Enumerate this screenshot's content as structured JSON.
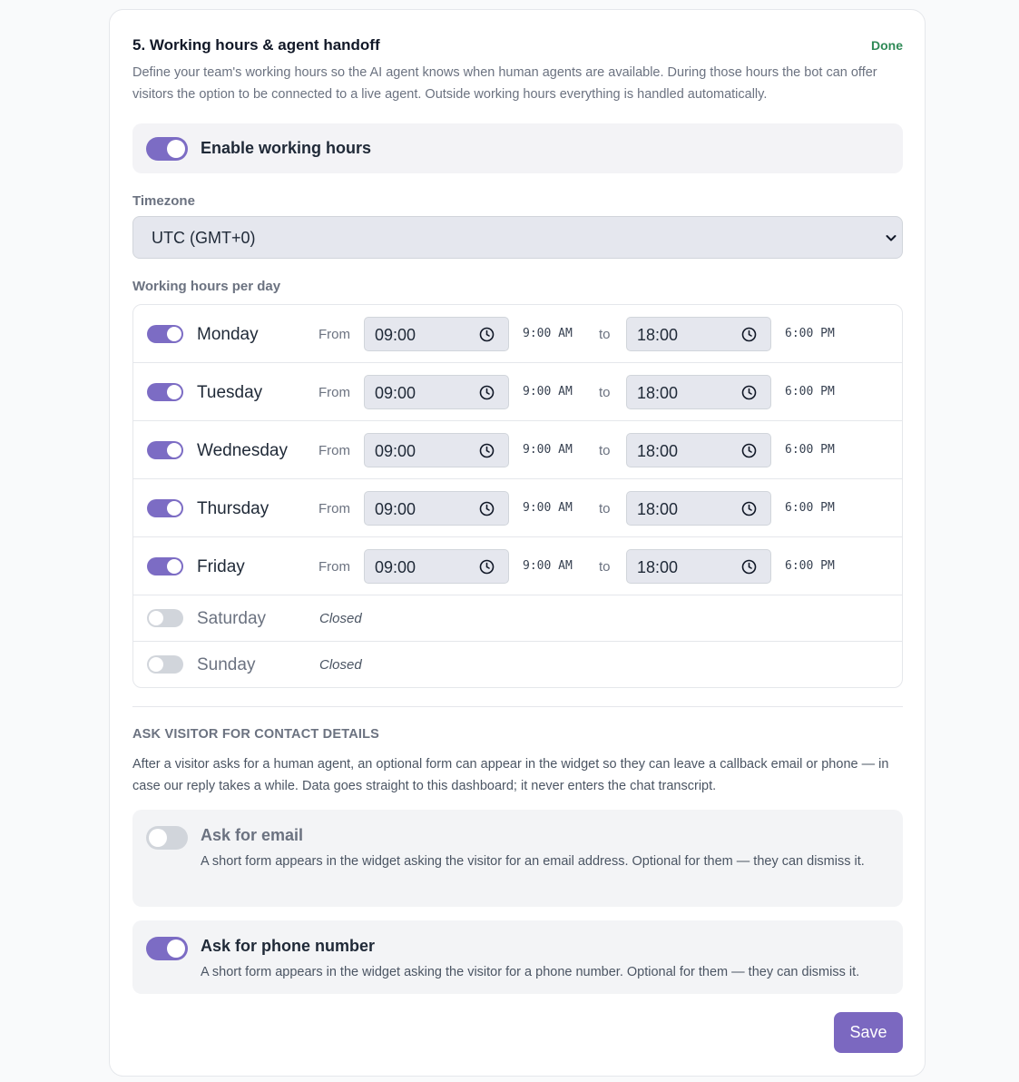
{
  "section": {
    "title": "5. Working hours & agent handoff",
    "status": "Done",
    "description": "Define your team's working hours so the AI agent knows when human agents are available. During those hours the bot can offer visitors the option to be connected to a live agent. Outside working hours everything is handled automatically."
  },
  "enable": {
    "label": "Enable working hours",
    "enabled": true
  },
  "timezone": {
    "label": "Timezone",
    "value": "UTC (GMT+0)"
  },
  "hours": {
    "label": "Working hours per day",
    "from_label": "From",
    "to_label": "to",
    "closed_label": "Closed",
    "days": [
      {
        "name": "Monday",
        "enabled": true,
        "from": "09:00",
        "from_12h": "9:00 AM",
        "to": "18:00",
        "to_12h": "6:00 PM"
      },
      {
        "name": "Tuesday",
        "enabled": true,
        "from": "09:00",
        "from_12h": "9:00 AM",
        "to": "18:00",
        "to_12h": "6:00 PM"
      },
      {
        "name": "Wednesday",
        "enabled": true,
        "from": "09:00",
        "from_12h": "9:00 AM",
        "to": "18:00",
        "to_12h": "6:00 PM"
      },
      {
        "name": "Thursday",
        "enabled": true,
        "from": "09:00",
        "from_12h": "9:00 AM",
        "to": "18:00",
        "to_12h": "6:00 PM"
      },
      {
        "name": "Friday",
        "enabled": true,
        "from": "09:00",
        "from_12h": "9:00 AM",
        "to": "18:00",
        "to_12h": "6:00 PM"
      },
      {
        "name": "Saturday",
        "enabled": false
      },
      {
        "name": "Sunday",
        "enabled": false
      }
    ]
  },
  "contact": {
    "title": "ASK VISITOR FOR CONTACT DETAILS",
    "description": "After a visitor asks for a human agent, an optional form can appear in the widget so they can leave a callback email or phone — in case our reply takes a while. Data goes straight to this dashboard; it never enters the chat transcript.",
    "email": {
      "title": "Ask for email",
      "description": "A short form appears in the widget asking the visitor for an email address. Optional for them — they can dismiss it.",
      "enabled": false
    },
    "phone": {
      "title": "Ask for phone number",
      "description": "A short form appears in the widget asking the visitor for a phone number. Optional for them — they can dismiss it.",
      "enabled": true
    }
  },
  "actions": {
    "save_label": "Save"
  },
  "colors": {
    "accent": "#7c6cc4",
    "done": "#2f8a57"
  }
}
